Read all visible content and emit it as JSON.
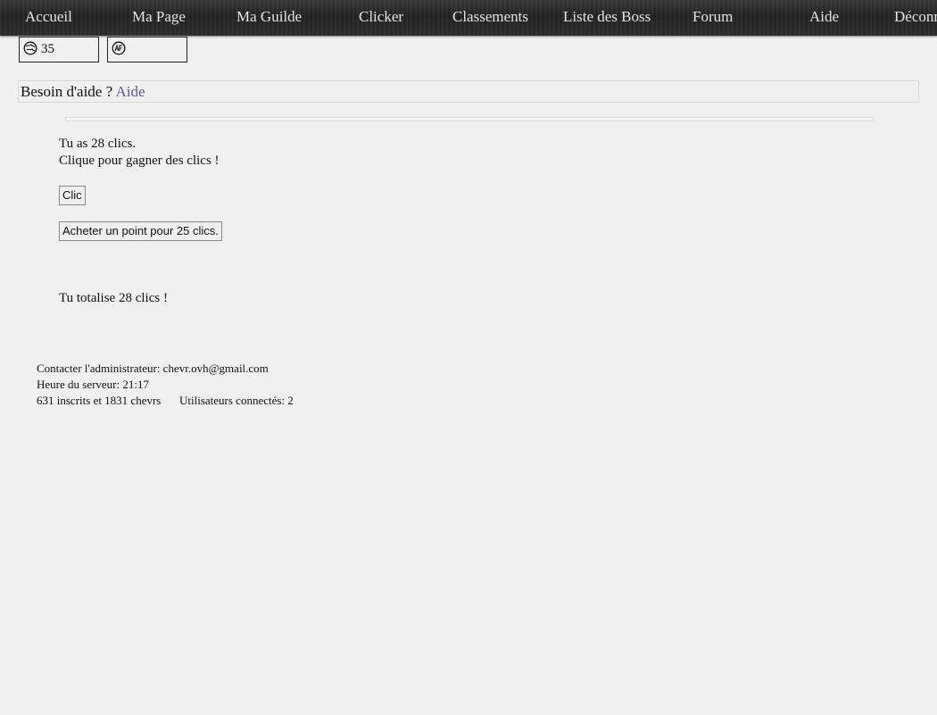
{
  "nav": {
    "items": [
      "Accueil",
      "Ma Page",
      "Ma Guilde",
      "Clicker",
      "Classements",
      "Liste des Boss",
      "Forum",
      "Aide",
      "Déconnexion"
    ]
  },
  "stats": {
    "box1_value": "35",
    "box2_value": ""
  },
  "help": {
    "prefix": "Besoin d'aide ? ",
    "link": "Aide"
  },
  "clicker": {
    "clicks_line": "Tu as 28 clics.",
    "instruction": "Clique pour gagner des clics !",
    "click_button": "Clic",
    "buy_button": "Acheter un point pour 25 clics.",
    "total_line": "Tu totalise 28 clics !"
  },
  "footer": {
    "contact": "Contacter l'administrateur: chevr.ovh@gmail.com",
    "server_time": "Heure du serveur: 21:17",
    "members": "631 inscrits et 1831 chevrs",
    "online": "Utilisateurs connectés: 2"
  }
}
